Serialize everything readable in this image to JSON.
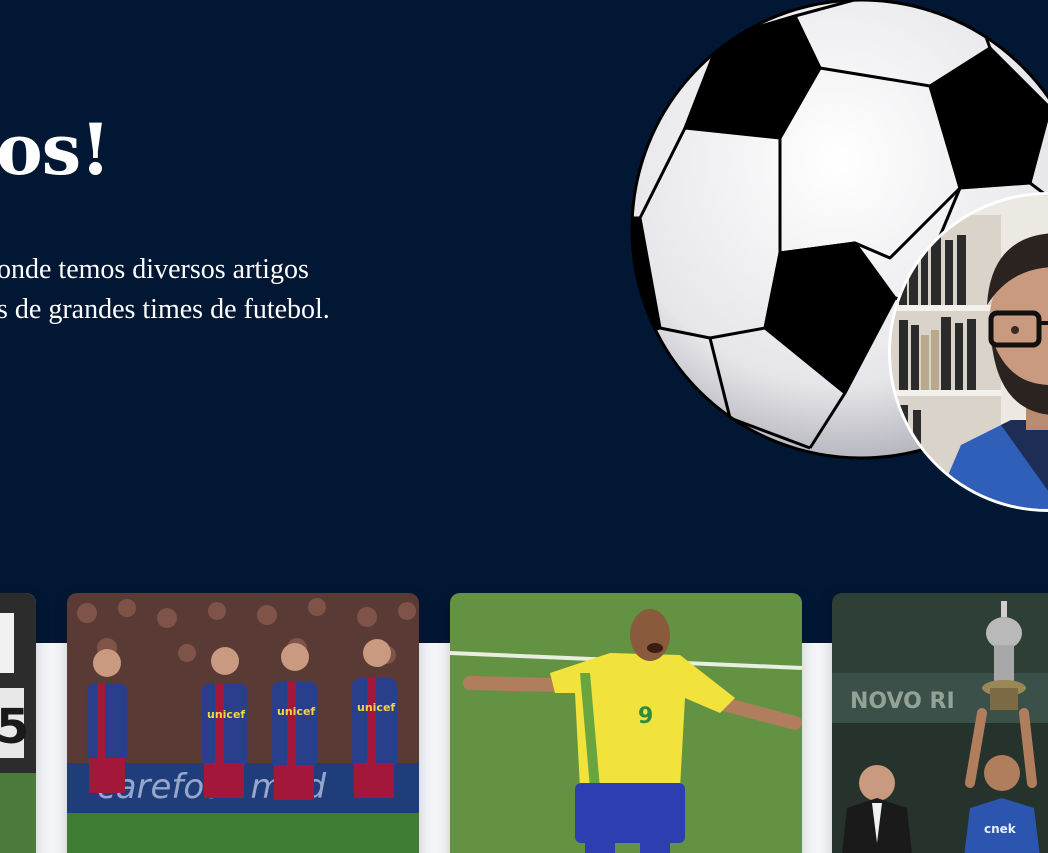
{
  "hero": {
    "title": "os!",
    "description": [
      "onde temos diversos artigos",
      "s de grandes times de futebol."
    ]
  },
  "images": {
    "ball": "soccer-ball-illustration",
    "avatar": "author-photo",
    "cards": [
      "partial-card-image",
      "barcelona-players-celebrating",
      "ronaldo-brazil-celebrating",
      "cruzeiro-trophy-lift"
    ]
  },
  "colors": {
    "hero_background": "#021734",
    "page_background": "#f4f5f9",
    "text": "#ffffff"
  }
}
